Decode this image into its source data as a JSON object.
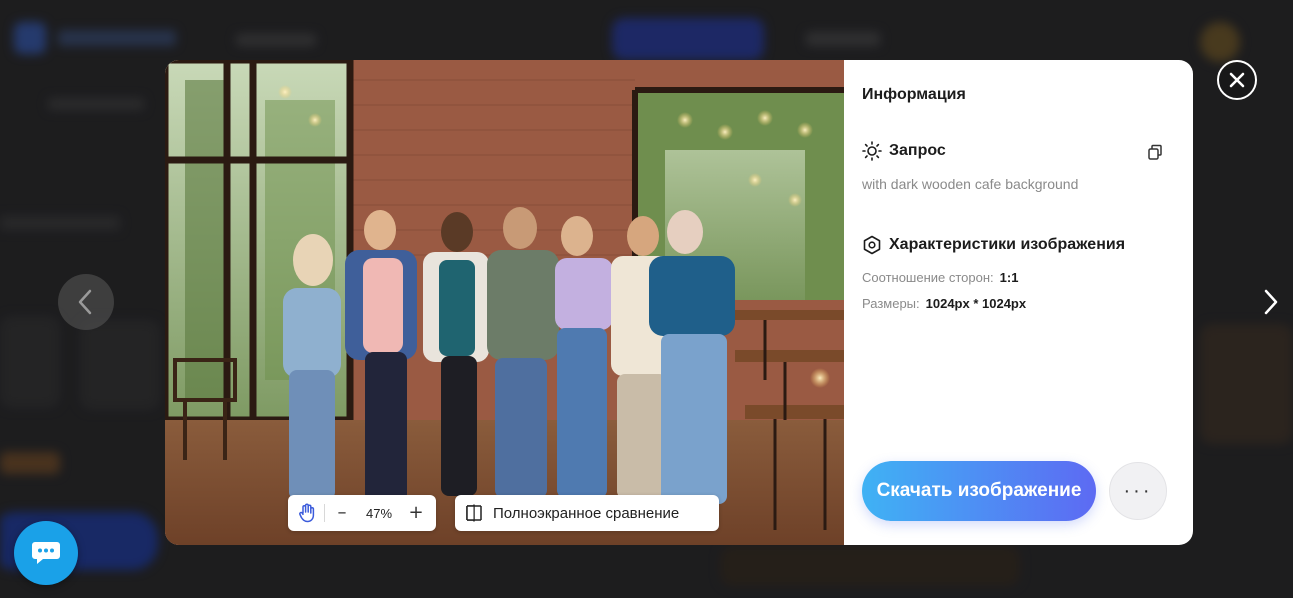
{
  "viewer": {
    "prev_icon": "chevron-left-icon",
    "next_icon": "chevron-right-icon",
    "close_icon": "close-icon"
  },
  "image_toolbar": {
    "hand_icon": "hand-pan-icon",
    "zoom_level": "47%",
    "zoom_out_label": "–",
    "zoom_in_label": "+",
    "compare_icon": "split-compare-icon",
    "compare_label": "Полноэкранное сравнение"
  },
  "info": {
    "title": "Информация",
    "prompt": {
      "title": "Запрос",
      "icon": "sun-icon",
      "text": "with dark wooden cafe background",
      "copy_icon": "copy-icon"
    },
    "specs": {
      "title": "Характеристики изображения",
      "icon": "hexagon-icon",
      "aspect_label": "Соотношение сторон:",
      "aspect_value": "1:1",
      "size_label": "Размеры:",
      "size_value": "1024px * 1024px"
    },
    "download_label": "Скачать изображение",
    "more_label": "···"
  },
  "colors": {
    "download_gradient_start": "#3fb2f4",
    "download_gradient_end": "#5d6af3",
    "chat_bubble": "#1aa1e8",
    "hand_icon": "#3b5bdb"
  },
  "chat": {
    "icon": "chat-bubble-icon"
  }
}
